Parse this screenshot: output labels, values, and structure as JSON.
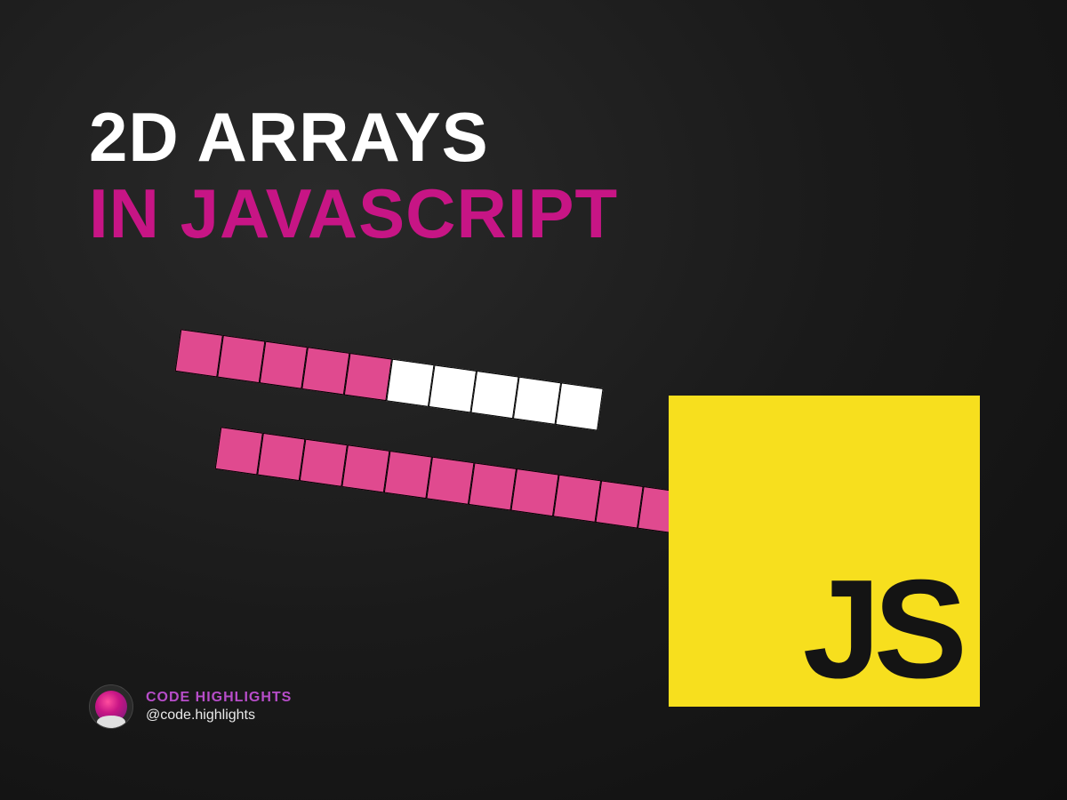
{
  "title": {
    "line1": "2D ARRAYS",
    "line2": "IN JAVASCRIPT"
  },
  "arrays": {
    "bar1": {
      "cells": [
        "pink",
        "pink",
        "pink",
        "pink",
        "pink",
        "white",
        "white",
        "white",
        "white",
        "white"
      ]
    },
    "bar2": {
      "cells": [
        "pink",
        "pink",
        "pink",
        "pink",
        "pink",
        "pink",
        "pink",
        "pink",
        "pink",
        "pink",
        "pink"
      ]
    }
  },
  "logo": {
    "text": "JS"
  },
  "footer": {
    "brand": "CODE HIGHLIGHTS",
    "handle": "@code.highlights"
  },
  "colors": {
    "accent_pink": "#c71585",
    "cell_pink": "#e04a8f",
    "js_yellow": "#f7df1e",
    "brand_purple": "#b74dc9"
  }
}
